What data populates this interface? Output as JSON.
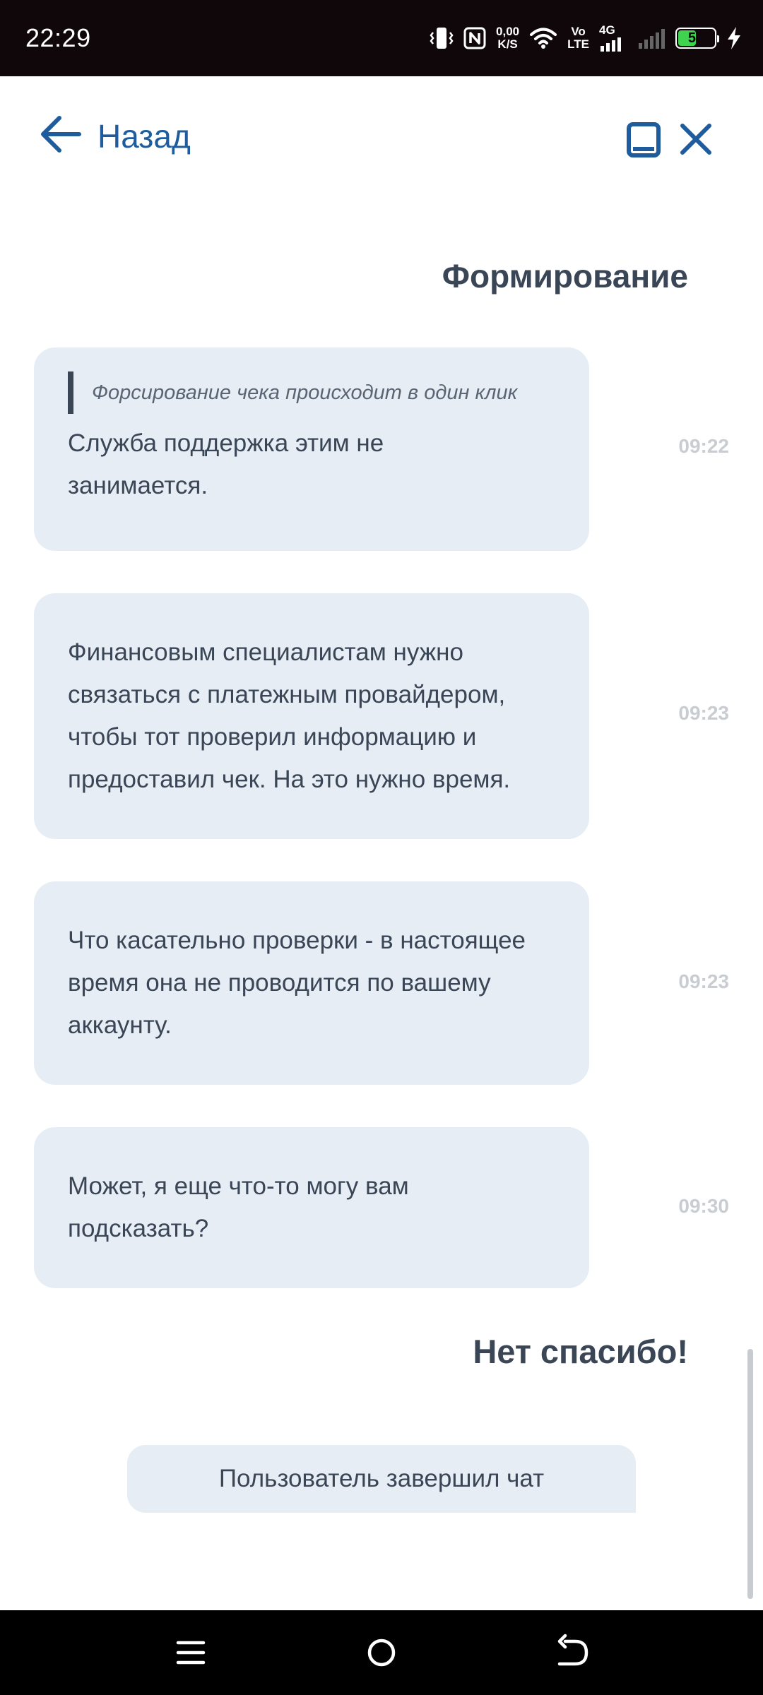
{
  "status_bar": {
    "time": "22:29",
    "speed_value": "0,00",
    "speed_unit": "K/S",
    "volte_top": "Vo",
    "volte_bottom": "LTE",
    "network": "4G",
    "battery": "50",
    "battery_level": 0.5,
    "icons": [
      "vibrate-icon",
      "nfc-icon",
      "wifi-icon",
      "signal-icon",
      "signal-weak-icon",
      "charging-icon"
    ]
  },
  "header": {
    "back_label": "Назад",
    "icons": [
      "arrow-left-icon",
      "minimize-icon",
      "close-icon"
    ]
  },
  "chat": {
    "user_message_top": "Формирование",
    "messages": [
      {
        "quote": "Форсирование чека происходит в один клик",
        "lines": [
          "Служба поддержка этим не",
          "занимается."
        ],
        "time": "09:22"
      },
      {
        "lines": [
          "Финансовым специалистам нужно",
          "связаться с платежным провайдером,",
          "чтобы тот проверил информацию и",
          "предоставил чек. На это нужно время."
        ],
        "time": "09:23"
      },
      {
        "lines": [
          "Что касательно проверки - в настоящее",
          "время она не проводится по вашему",
          "аккаунту."
        ],
        "time": "09:23"
      },
      {
        "lines": [
          "Может, я еще что-то могу вам",
          "подсказать?"
        ],
        "time": "09:30"
      }
    ],
    "user_message_bottom": "Нет спасибо!",
    "system_message": "Пользователь завершил чат"
  },
  "nav_bar": {
    "icons": [
      "menu-icon",
      "home-icon",
      "back-icon"
    ]
  },
  "colors": {
    "accent": "#1f5c9e",
    "bubble": "#e7edf5",
    "text": "#3a4656",
    "timestamp": "#c9cdd2"
  }
}
